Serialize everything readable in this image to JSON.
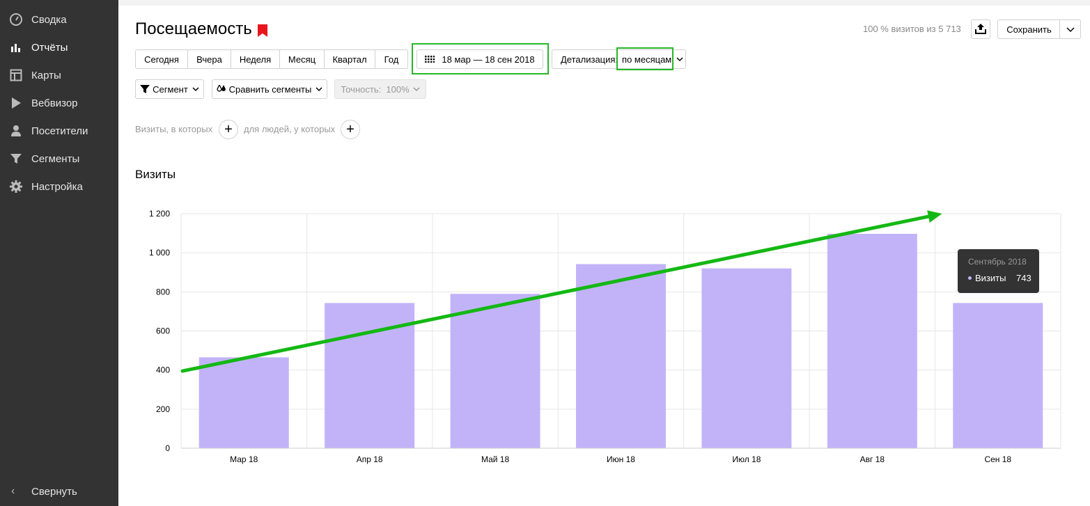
{
  "sidebar": {
    "items": [
      {
        "label": "Сводка",
        "icon": "gauge-icon",
        "active": false
      },
      {
        "label": "Отчёты",
        "icon": "bar-chart-icon",
        "active": true
      },
      {
        "label": "Карты",
        "icon": "layout-map-icon",
        "active": false
      },
      {
        "label": "Вебвизор",
        "icon": "play-icon",
        "active": false
      },
      {
        "label": "Посетители",
        "icon": "person-icon",
        "active": false
      },
      {
        "label": "Сегменты",
        "icon": "funnel-icon",
        "active": false
      },
      {
        "label": "Настройка",
        "icon": "gear-icon",
        "active": false
      }
    ],
    "collapse_label": "Свернуть"
  },
  "header": {
    "title": "Посещаемость",
    "stat": "100 % визитов из 5 713",
    "save_label": "Сохранить"
  },
  "periods": [
    "Сегодня",
    "Вчера",
    "Неделя",
    "Месяц",
    "Квартал",
    "Год"
  ],
  "date_range": "18 мар — 18 сен 2018",
  "detail": {
    "label": "Детализация:",
    "value": "по месяцам"
  },
  "segment_label": "Сегмент",
  "compare_label": "Сравнить сегменты",
  "accuracy_label": "Точность:  100%",
  "filters": {
    "visits_text": "Визиты, в которых",
    "people_text": "для людей, у которых"
  },
  "section_title": "Визиты",
  "colors": {
    "bar": "#c2b3f9",
    "arrow": "#14b814",
    "highlight": "#26b826",
    "bookmark": "#e8151d",
    "sidebar": "#333333"
  },
  "chart_data": {
    "type": "bar",
    "categories": [
      "Мар 18",
      "Апр 18",
      "Май 18",
      "Июн 18",
      "Июл 18",
      "Авг 18",
      "Сен 18"
    ],
    "series": [
      {
        "name": "Визиты",
        "values": [
          465,
          743,
          790,
          942,
          920,
          1097,
          743
        ]
      }
    ],
    "ylim": [
      0,
      1200
    ],
    "yticks": [
      "0",
      "200",
      "400",
      "600",
      "800",
      "1 000",
      "1 200"
    ],
    "ytick_values": [
      0,
      200,
      400,
      600,
      800,
      1000,
      1200
    ],
    "grid": true,
    "trend_arrow": {
      "from": 395,
      "to": 1200
    }
  },
  "tooltip": {
    "title": "Сентябрь 2018",
    "series_name": "Визиты",
    "value": "743"
  }
}
